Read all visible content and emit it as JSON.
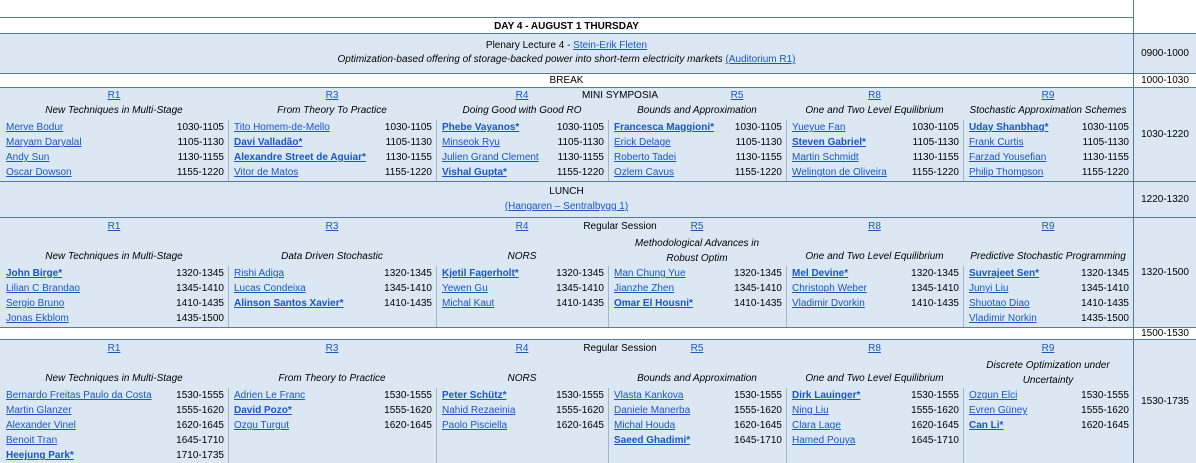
{
  "day_title": "DAY 4 - AUGUST 1 THURSDAY",
  "plenary": {
    "title_prefix": "Plenary Lecture 4 - ",
    "speaker": "Stein-Erik Fleten",
    "talk": "Optimization-based offering of storage-backed power into short-term electricity markets ",
    "room": "(Auditorium R1)",
    "time": "0900-1000"
  },
  "break": {
    "label": "BREAK",
    "time": "1000-1030"
  },
  "lunch": {
    "label": "LUNCH",
    "place": "(Hangaren – Sentralbygg 1)",
    "time": "1220-1320"
  },
  "gap_time": "1500-1530",
  "sessions": [
    {
      "time": "1030-1220",
      "label": "MINI SYMPOSIA",
      "tracks": [
        {
          "room": "R1",
          "title": "New Techniques in Multi-Stage",
          "talks": [
            {
              "name": "Merve Bodur",
              "time": "1030-1105",
              "bold": false
            },
            {
              "name": "Maryam Daryalal",
              "time": "1105-1130",
              "bold": false
            },
            {
              "name": "Andy Sun",
              "time": "1130-1155",
              "bold": false
            },
            {
              "name": "Oscar Dowson",
              "time": "1155-1220",
              "bold": false
            }
          ]
        },
        {
          "room": "R3",
          "title": "From Theory To Practice",
          "talks": [
            {
              "name": "Tito Homem-de-Mello",
              "time": "1030-1105",
              "bold": false
            },
            {
              "name": "Davi Valladão*",
              "time": "1105-1130",
              "bold": true
            },
            {
              "name": "Alexandre Street de Aguiar*",
              "time": "1130-1155",
              "bold": true
            },
            {
              "name": "Vitor de Matos",
              "time": "1155-1220",
              "bold": false
            }
          ]
        },
        {
          "room": "R4",
          "title": "Doing Good with Good RO",
          "talks": [
            {
              "name": "Phebe Vayanos*",
              "time": "1030-1105",
              "bold": true
            },
            {
              "name": "Minseok Ryu",
              "time": "1105-1130",
              "bold": false
            },
            {
              "name": "Julien Grand Clement",
              "time": "1130-1155",
              "bold": false
            },
            {
              "name": "Vishal Gupta*",
              "time": "1155-1220",
              "bold": true
            }
          ]
        },
        {
          "room": "R5",
          "title": "Bounds and Approximation",
          "talks": [
            {
              "name": "Francesca Maggioni*",
              "time": "1030-1105",
              "bold": true
            },
            {
              "name": "Erick Delage",
              "time": "1105-1130",
              "bold": false
            },
            {
              "name": "Roberto Tadei",
              "time": "1130-1155",
              "bold": false
            },
            {
              "name": "Ozlem Cavus",
              "time": "1155-1220",
              "bold": false
            }
          ]
        },
        {
          "room": "R8",
          "title": "One and Two Level Equilibrium",
          "talks": [
            {
              "name": "Yueyue Fan",
              "time": "1030-1105",
              "bold": false
            },
            {
              "name": "Steven Gabriel*",
              "time": "1105-1130",
              "bold": true
            },
            {
              "name": "Martin Schmidt",
              "time": "1130-1155",
              "bold": false
            },
            {
              "name": "Welington de Oliveira",
              "time": "1155-1220",
              "bold": false
            }
          ]
        },
        {
          "room": "R9",
          "title": "Stochastic Approximation Schemes",
          "talks": [
            {
              "name": "Uday Shanbhag*",
              "time": "1030-1105",
              "bold": true
            },
            {
              "name": "Frank Curtis",
              "time": "1105-1130",
              "bold": false
            },
            {
              "name": "Farzad Yousefian",
              "time": "1130-1155",
              "bold": false
            },
            {
              "name": "Philip Thompson",
              "time": "1155-1220",
              "bold": false
            }
          ]
        }
      ]
    },
    {
      "time": "1320-1500",
      "label": "Regular Session",
      "tracks": [
        {
          "room": "R1",
          "title": "New Techniques in Multi-Stage",
          "talks": [
            {
              "name": "John Birge*",
              "time": "1320-1345",
              "bold": true
            },
            {
              "name": "Lilian C Brandao",
              "time": "1345-1410",
              "bold": false
            },
            {
              "name": "Sergio Bruno",
              "time": "1410-1435",
              "bold": false
            },
            {
              "name": "Jonas Ekblom",
              "time": "1435-1500",
              "bold": false
            }
          ]
        },
        {
          "room": "R3",
          "title": "Data Driven Stochastic",
          "talks": [
            {
              "name": "Rishi Adiga",
              "time": "1320-1345",
              "bold": false
            },
            {
              "name": "Lucas Condeixa",
              "time": "1345-1410",
              "bold": false
            },
            {
              "name": "Alinson Santos Xavier*",
              "time": "1410-1435",
              "bold": true
            }
          ]
        },
        {
          "room": "R4",
          "title": "NORS",
          "talks": [
            {
              "name": "Kjetil Fagerholt*",
              "time": "1320-1345",
              "bold": true
            },
            {
              "name": "Yewen Gu",
              "time": "1345-1410",
              "bold": false
            },
            {
              "name": "Michal Kaut",
              "time": "1410-1435",
              "bold": false
            }
          ]
        },
        {
          "room": "R5",
          "title": "Methodological Advances in Robust Optim",
          "talks": [
            {
              "name": "Man Chung Yue",
              "time": "1320-1345",
              "bold": false
            },
            {
              "name": "Jianzhe Zhen",
              "time": "1345-1410",
              "bold": false
            },
            {
              "name": "Omar El Housni*",
              "time": "1410-1435",
              "bold": true
            }
          ]
        },
        {
          "room": "R8",
          "title": "One and Two Level Equilibrium",
          "talks": [
            {
              "name": "Mel Devine*",
              "time": "1320-1345",
              "bold": true
            },
            {
              "name": "Christoph Weber",
              "time": "1345-1410",
              "bold": false
            },
            {
              "name": "Vladimir Dvorkin",
              "time": "1410-1435",
              "bold": false
            }
          ]
        },
        {
          "room": "R9",
          "title": "Predictive Stochastic Programming",
          "talks": [
            {
              "name": "Suvrajeet Sen*",
              "time": "1320-1345",
              "bold": true
            },
            {
              "name": "Junyi Liu",
              "time": "1345-1410",
              "bold": false
            },
            {
              "name": "Shuotao Diao",
              "time": "1410-1435",
              "bold": false
            },
            {
              "name": "Vladimir Norkin",
              "time": "1435-1500",
              "bold": false
            }
          ]
        }
      ]
    },
    {
      "time": "1530-1735",
      "label": "Regular Session",
      "tracks": [
        {
          "room": "R1",
          "title": "New Techniques in Multi-Stage",
          "talks": [
            {
              "name": "Bernardo Freitas Paulo da Costa",
              "time": "1530-1555",
              "bold": false
            },
            {
              "name": "Martin Glanzer",
              "time": "1555-1620",
              "bold": false
            },
            {
              "name": "Alexander Vinel",
              "time": "1620-1645",
              "bold": false
            },
            {
              "name": "Benoit Tran",
              "time": "1645-1710",
              "bold": false
            },
            {
              "name": "Heejung Park*",
              "time": "1710-1735",
              "bold": true
            }
          ]
        },
        {
          "room": "R3",
          "title": "From Theory to Practice",
          "talks": [
            {
              "name": "Adrien Le Franc",
              "time": "1530-1555",
              "bold": false
            },
            {
              "name": "David Pozo*",
              "time": "1555-1620",
              "bold": true
            },
            {
              "name": "Ozgu Turgut",
              "time": "1620-1645",
              "bold": false
            }
          ]
        },
        {
          "room": "R4",
          "title": "NORS",
          "talks": [
            {
              "name": "Peter Schütz*",
              "time": "1530-1555",
              "bold": true
            },
            {
              "name": "Nahid Rezaeinia",
              "time": "1555-1620",
              "bold": false
            },
            {
              "name": "Paolo Pisciella",
              "time": "1620-1645",
              "bold": false
            }
          ]
        },
        {
          "room": "R5",
          "title": "Bounds and Approximation",
          "talks": [
            {
              "name": "Vlasta Kankova",
              "time": "1530-1555",
              "bold": false
            },
            {
              "name": "Daniele Manerba",
              "time": "1555-1620",
              "bold": false
            },
            {
              "name": "Michal Houda",
              "time": "1620-1645",
              "bold": false
            },
            {
              "name": "Saeed Ghadimi*",
              "time": "1645-1710",
              "bold": true
            }
          ]
        },
        {
          "room": "R8",
          "title": "One and Two Level Equilibrium",
          "talks": [
            {
              "name": "Dirk Lauinger*",
              "time": "1530-1555",
              "bold": true
            },
            {
              "name": "Ning Liu",
              "time": "1555-1620",
              "bold": false
            },
            {
              "name": "Clara Lage",
              "time": "1620-1645",
              "bold": false
            },
            {
              "name": "Hamed Pouya",
              "time": "1645-1710",
              "bold": false
            }
          ]
        },
        {
          "room": "R9",
          "title": "Discrete Optimization under Uncertainty",
          "talks": [
            {
              "name": "Ozgun Elci",
              "time": "1530-1555",
              "bold": false
            },
            {
              "name": "Evren Güney",
              "time": "1555-1620",
              "bold": false
            },
            {
              "name": "Can Li*",
              "time": "1620-1645",
              "bold": true
            }
          ]
        }
      ]
    }
  ],
  "colors": {
    "link": "#1a56c4",
    "band": "#dbe8f4",
    "border": "#5a7a9a"
  }
}
